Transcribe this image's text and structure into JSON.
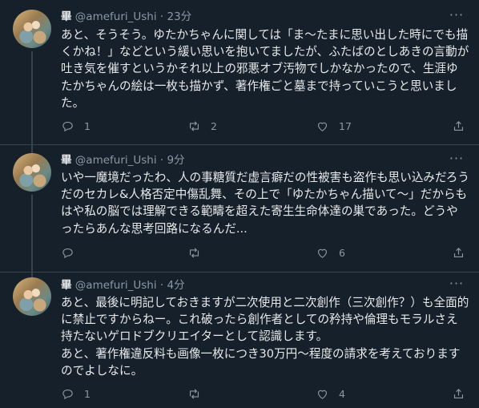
{
  "tweets": [
    {
      "name": "畢",
      "handle": "@amefuri_Ushi",
      "time": "· 23分",
      "text": "あと、そうそう。ゆたかちゃんに関しては「ま〜たまに思い出した時にでも描くかね！」などという緩い思いを抱いてましたが、ふたばのとしあきの言動が吐き気を催すというかそれ以上の邪悪オブ汚物でしかなかったので、生涯ゆたかちゃんの絵は一枚も描かず、著作権ごと墓まで持っていこうと思いました。",
      "reply_count": "1",
      "retweet_count": "2",
      "like_count": "17"
    },
    {
      "name": "畢",
      "handle": "@amefuri_Ushi",
      "time": "· 9分",
      "text": "いや一魔境だったわ、人の事糖質だ虚言癖だの性被害も盗作も思い込みだろうだのセカレ&人格否定中傷乱舞、その上で「ゆたかちゃん描いて〜」だからもはや私の脳では理解できる範疇を超えた寄生生命体達の巣であった。どうやったらあんな思考回路になるんだ...",
      "reply_count": "",
      "retweet_count": "",
      "like_count": "6"
    },
    {
      "name": "畢",
      "handle": "@amefuri_Ushi",
      "time": "· 4分",
      "text": "あと、最後に明記しておきますが二次使用と二次創作（三次創作？）も全面的に禁止ですからねー。これ破ったら創作者としての矜持や倫理もモラルさえ持たないゲロドブクリエイターとして認識します。\nあと、著作権違反料も画像一枚につき30万円〜程度の請求を考えておりますのでよしなに。",
      "reply_count": "1",
      "retweet_count": "",
      "like_count": "4"
    }
  ],
  "icons": {
    "more": "more-icon",
    "reply": "reply-icon",
    "retweet": "retweet-icon",
    "like": "heart-icon",
    "share": "share-icon"
  },
  "colors": {
    "background": "#15202b",
    "text": "#e7e9ea",
    "muted": "#8b98a5",
    "border": "#38444d"
  }
}
